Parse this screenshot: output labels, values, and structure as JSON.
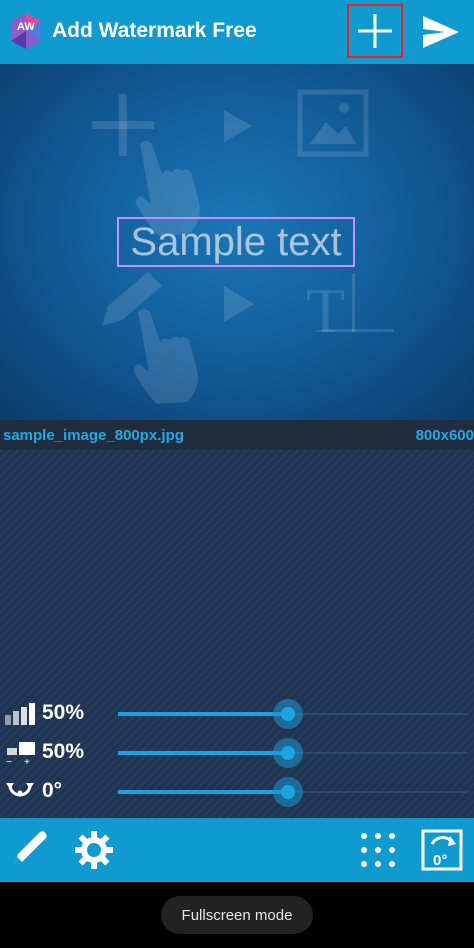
{
  "app": {
    "title": "Add Watermark Free",
    "logo_text": "AW",
    "accent_color": "#0f9bd0"
  },
  "toolbar": {
    "add_icon": "plus-icon",
    "send_icon": "send-icon"
  },
  "preview": {
    "watermark_text": "Sample text",
    "background_icons": [
      "plus-icon",
      "play-icon",
      "image-icon",
      "hand-pointer-icon",
      "pencil-icon",
      "text-cursor-icon"
    ]
  },
  "file": {
    "name": "sample_image_800px.jpg",
    "size": "800x600"
  },
  "sliders": [
    {
      "icon": "opacity-icon",
      "value_label": "50%",
      "value": 0.5
    },
    {
      "icon": "scale-icon",
      "value_label": "50%",
      "value": 0.5
    },
    {
      "icon": "rotation-icon",
      "value_label": "0°",
      "value": 0.5
    }
  ],
  "bottom_toolbar": {
    "edit_icon": "pencil-icon",
    "settings_icon": "gear-icon",
    "grid_icon": "grid-dots-icon",
    "rotate_icon": "rotate-icon",
    "rotate_label": "0°"
  },
  "navbar": {
    "fullscreen_label": "Fullscreen mode"
  }
}
